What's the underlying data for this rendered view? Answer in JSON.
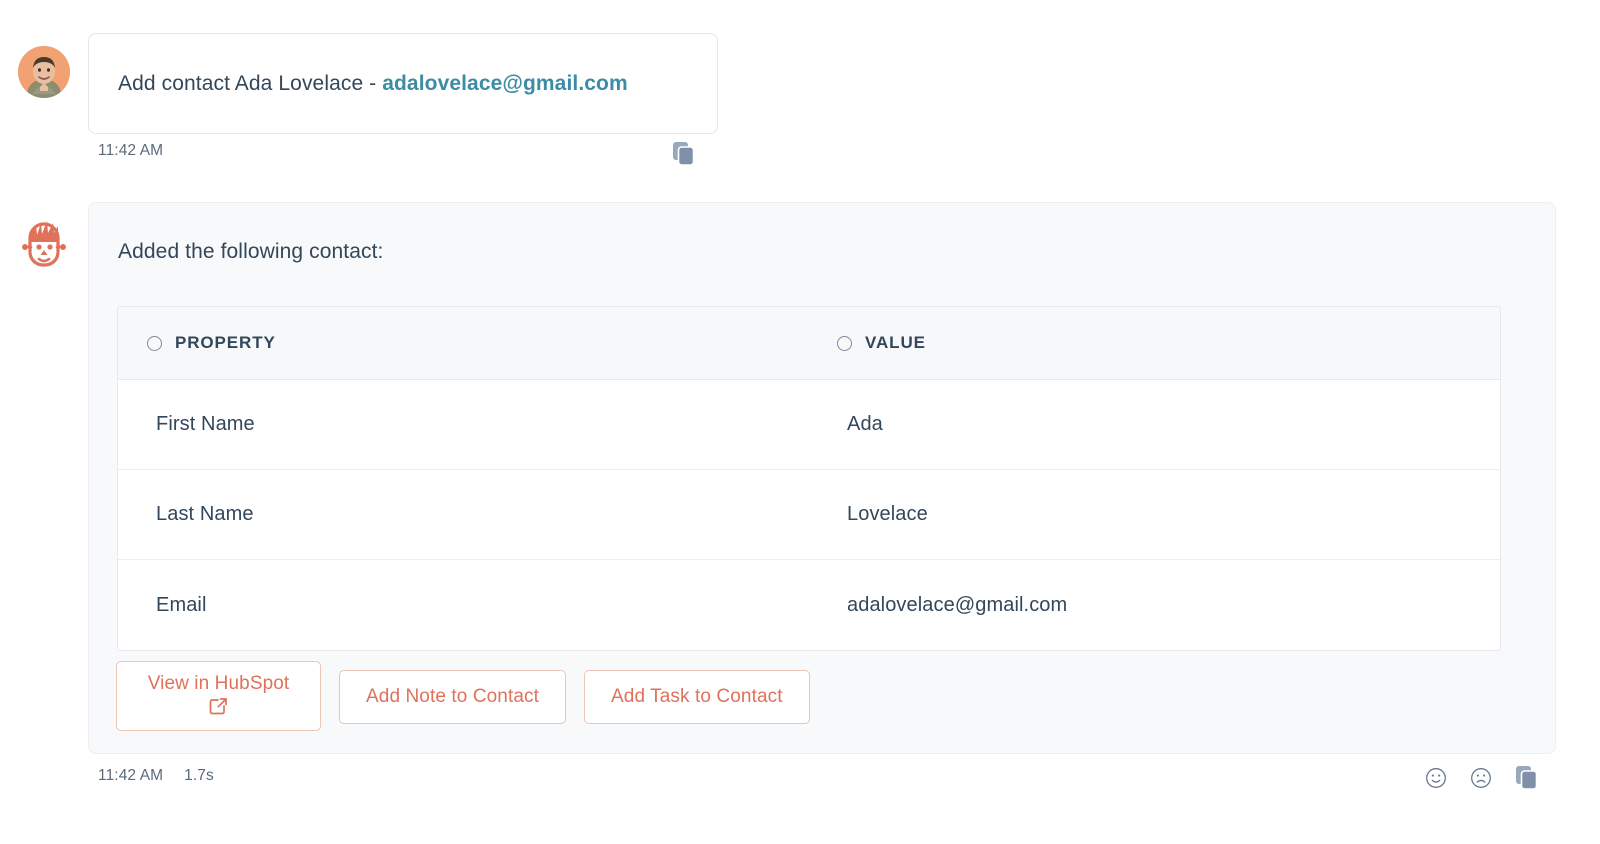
{
  "user_message": {
    "avatar_icon": "user-photo-avatar",
    "text_prefix": "Add contact Ada Lovelace - ",
    "email": "adalovelace@gmail.com",
    "timestamp": "11:42 AM",
    "copy_icon": "copy-icon"
  },
  "bot_message": {
    "avatar_icon": "hubspot-bot-face-icon",
    "intro_text": "Added the following contact:",
    "table": {
      "headers": [
        {
          "icon": "radio-circle-icon",
          "label": "PROPERTY"
        },
        {
          "icon": "radio-circle-icon",
          "label": "VALUE"
        }
      ],
      "rows": [
        {
          "property": "First Name",
          "value": "Ada"
        },
        {
          "property": "Last Name",
          "value": "Lovelace"
        },
        {
          "property": "Email",
          "value": "adalovelace@gmail.com"
        }
      ]
    },
    "actions": [
      {
        "label": "View in HubSpot",
        "icon": "external-link-icon",
        "style": "primary"
      },
      {
        "label": "Add Note to Contact",
        "icon": "",
        "style": "plain"
      },
      {
        "label": "Add Task to Contact",
        "icon": "",
        "style": "plain"
      }
    ],
    "timestamp": "11:42 AM",
    "duration": "1.7s",
    "footer_icons": [
      {
        "name": "thumbs-up-smiley-icon"
      },
      {
        "name": "thumbs-down-frowny-icon"
      },
      {
        "name": "copy-icon"
      }
    ]
  },
  "colors": {
    "accent_orange": "#e0715a",
    "link_teal": "#3d8ca5",
    "text_primary": "#33475b",
    "text_muted": "#5b6b7c",
    "card_bg": "#f7f9fb",
    "table_header_bg": "#f6f8fa",
    "copy_icon": "#7c8ca0"
  }
}
